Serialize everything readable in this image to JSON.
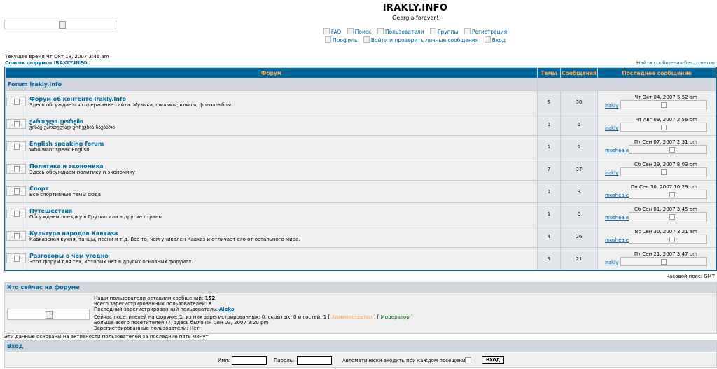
{
  "header": {
    "title": "IRAKLY.INFO",
    "description": "Georgia forever!",
    "nav_row1": [
      "FAQ",
      "Поиск",
      "Пользователи",
      "Группы",
      "Регистрация"
    ],
    "nav_row2": [
      "Профиль",
      "Войти и проверить личные сообщения",
      "Вход"
    ]
  },
  "page": {
    "current_time": "Текущее время Чт Окт 18, 2007 3:46 am",
    "index_link": "Список форумов IRAKLY.INFO",
    "unanswered_link": "Найти сообщения без ответов",
    "timezone": "Часовой пояс: GMT"
  },
  "forum_table": {
    "headers": [
      "Форум",
      "Темы",
      "Сообщения",
      "Последнее сообщение"
    ],
    "category": "Forum Irakly.Info",
    "forums": [
      {
        "name": "Форум об контенте Irakly.Info",
        "desc": "Здесь обсуждается содержание сайта. Музыка, фильмы, клипы, фотоальбом",
        "topics": "5",
        "posts": "38",
        "last_date": "Чт Окт 04, 2007 5:52 am",
        "last_user": "irakly"
      },
      {
        "name": "ქართული ფორუმი",
        "desc": "ვისაც ქართულად ურჩევნია საუბარი",
        "topics": "1",
        "posts": "1",
        "last_date": "Чт Авг 09, 2007 2:56 pm",
        "last_user": "irakly"
      },
      {
        "name": "English speaking forum",
        "desc": "Who want speak English",
        "topics": "1",
        "posts": "1",
        "last_date": "Пт Сен 07, 2007 2:31 pm",
        "last_user": "moshealex"
      },
      {
        "name": "Политика и экономика",
        "desc": "Здесь обсуждаем политику и экономику",
        "topics": "7",
        "posts": "37",
        "last_date": "Сб Сен 29, 2007 8:03 pm",
        "last_user": "irakly"
      },
      {
        "name": "Спорт",
        "desc": "Все спортивные темы сюда",
        "topics": "1",
        "posts": "9",
        "last_date": "Пн Сен 10, 2007 10:29 pm",
        "last_user": "moshealex"
      },
      {
        "name": "Путешествия",
        "desc": "Обсуждаем поездку в Грузию или в другие страны",
        "topics": "1",
        "posts": "8",
        "last_date": "Сб Сен 01, 2007 3:45 pm",
        "last_user": "moshealex"
      },
      {
        "name": "Культура народов Кавказа",
        "desc": "Кавказская кухня, танцы, песни и т.д. Все то, чем уникален Кавказ и отличает его от остального мира.",
        "topics": "4",
        "posts": "26",
        "last_date": "Вс Сен 30, 2007 3:21 am",
        "last_user": "moshealex"
      },
      {
        "name": "Разговоры о чем угодно",
        "desc": "Этот форум для тех, которых нет в других основных форумах.",
        "topics": "3",
        "posts": "21",
        "last_date": "Пт Сен 21, 2007 3:47 pm",
        "last_user": "irakly"
      }
    ]
  },
  "online": {
    "title": "Кто сейчас на форуме",
    "line1_prefix": "Наши пользователи оставили сообщений:",
    "line1_value": "152",
    "line2_prefix": "Всего зарегистрированных пользователей:",
    "line2_value": "8",
    "line3_prefix": "Последний зарегистрированный пользователь:",
    "line3_value": "Aleko",
    "line4_prefix": "Сейчас посетителей на форуме:",
    "line4_value": "1",
    "line4_rest": ", из них зарегистрированных: 0, скрытых: 0 и гостей: 1  [",
    "admin_label": "Администратор",
    "between": "]  [",
    "mod_label": "Модератор",
    "close": "]",
    "line5": "Больше всего посетителей (7) здесь было Пн Сен 03, 2007 3:20 pm",
    "line6": "Зарегистрированные пользователи: Нет",
    "note": "Эти данные основаны на активности пользователей за последние пять минут"
  },
  "login": {
    "title": "Вход",
    "username_label": "Имя:",
    "password_label": "Пароль:",
    "autologin_label": "Автоматически входить при каждом посещении",
    "button": "Вход"
  }
}
